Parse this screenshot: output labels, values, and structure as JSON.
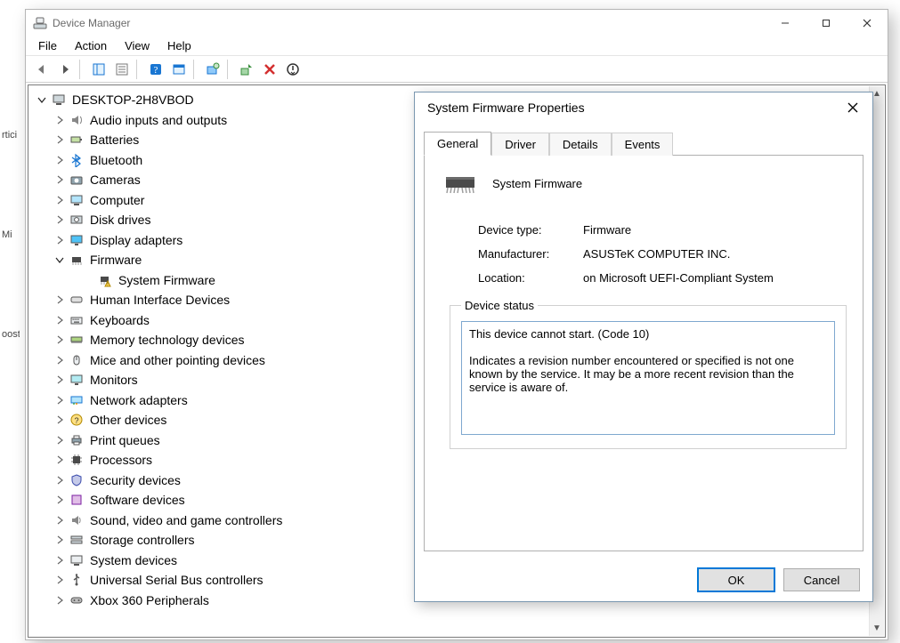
{
  "window": {
    "title": "Device Manager",
    "menu": [
      "File",
      "Action",
      "View",
      "Help"
    ]
  },
  "toolbar": {
    "back": "Back",
    "forward": "Forward",
    "properties_toplevel": "Show/Hide Console Tree",
    "show_hidden": "Properties",
    "help": "Help",
    "action_center": "Actions",
    "scan": "Scan for hardware changes",
    "update_driver": "Update Device Driver",
    "uninstall": "Uninstall Device",
    "enable": "Enable Device"
  },
  "tree": {
    "root": "DESKTOP-2H8VBOD",
    "nodes": [
      {
        "label": "Audio inputs and outputs",
        "icon": "audio"
      },
      {
        "label": "Batteries",
        "icon": "battery"
      },
      {
        "label": "Bluetooth",
        "icon": "bluetooth"
      },
      {
        "label": "Cameras",
        "icon": "camera"
      },
      {
        "label": "Computer",
        "icon": "computer"
      },
      {
        "label": "Disk drives",
        "icon": "disk"
      },
      {
        "label": "Display adapters",
        "icon": "display"
      },
      {
        "label": "Firmware",
        "icon": "firmware",
        "expanded": true,
        "children": [
          {
            "label": "System Firmware",
            "icon": "firmware-warn"
          }
        ]
      },
      {
        "label": "Human Interface Devices",
        "icon": "hid"
      },
      {
        "label": "Keyboards",
        "icon": "keyboard"
      },
      {
        "label": "Memory technology devices",
        "icon": "memory"
      },
      {
        "label": "Mice and other pointing devices",
        "icon": "mouse"
      },
      {
        "label": "Monitors",
        "icon": "monitor"
      },
      {
        "label": "Network adapters",
        "icon": "network"
      },
      {
        "label": "Other devices",
        "icon": "other"
      },
      {
        "label": "Print queues",
        "icon": "printer"
      },
      {
        "label": "Processors",
        "icon": "cpu"
      },
      {
        "label": "Security devices",
        "icon": "security"
      },
      {
        "label": "Software devices",
        "icon": "software"
      },
      {
        "label": "Sound, video and game controllers",
        "icon": "sound"
      },
      {
        "label": "Storage controllers",
        "icon": "storage"
      },
      {
        "label": "System devices",
        "icon": "system"
      },
      {
        "label": "Universal Serial Bus controllers",
        "icon": "usb"
      },
      {
        "label": "Xbox 360 Peripherals",
        "icon": "xbox"
      }
    ]
  },
  "dialog": {
    "title": "System Firmware Properties",
    "tabs": [
      "General",
      "Driver",
      "Details",
      "Events"
    ],
    "active_tab": 0,
    "device_name": "System Firmware",
    "fields": {
      "device_type_label": "Device type:",
      "device_type_value": "Firmware",
      "manufacturer_label": "Manufacturer:",
      "manufacturer_value": "ASUSTeK COMPUTER INC.",
      "location_label": "Location:",
      "location_value": "on Microsoft UEFI-Compliant System"
    },
    "status_legend": "Device status",
    "status_text": "This device cannot start. (Code 10)\n\nIndicates a revision number encountered or specified is not one known by the service. It may be a more recent revision than the service is aware of.",
    "ok": "OK",
    "cancel": "Cancel"
  },
  "peek": {
    "a": "rtici",
    "b": "Mi",
    "c": "oost"
  }
}
